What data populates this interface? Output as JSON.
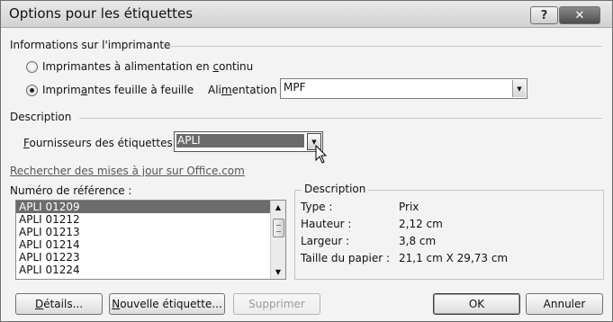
{
  "window": {
    "title": "Options pour les étiquettes",
    "help_label": "?",
    "close_label": "✕"
  },
  "printer_info": {
    "group_label": "Informations sur l'imprimante",
    "continuous_radio": {
      "pre": "Imprimantes à alimentation en ",
      "u": "c",
      "post": "ontinu",
      "checked": false
    },
    "sheet_radio": {
      "pre": "Imprim",
      "u": "a",
      "post": "ntes feuille à feuille",
      "checked": true
    },
    "feed": {
      "pre": "Ali",
      "u": "m",
      "post": "entation :",
      "value": "MPF"
    }
  },
  "description_section": {
    "group_label": "Description",
    "vendor": {
      "u": "F",
      "post": "ournisseurs des étiquettes :",
      "value": "APLI"
    }
  },
  "update_link": "Rechercher des mises à jour sur Office.com",
  "product_list": {
    "label": "Numéro de référence :",
    "items": [
      "APLI 01209",
      "APLI 01212",
      "APLI 01213",
      "APLI 01214",
      "APLI 01223",
      "APLI 01224"
    ],
    "selected_index": 0
  },
  "details": {
    "group_label": "Description",
    "rows": [
      {
        "key": "Type :",
        "value": "Prix"
      },
      {
        "key": "Hauteur :",
        "value": "2,12 cm"
      },
      {
        "key": "Largeur :",
        "value": "3,8 cm"
      },
      {
        "key": "Taille du papier :",
        "value": "21,1 cm X 29,73 cm"
      }
    ]
  },
  "buttons": {
    "details": {
      "u": "D",
      "post": "étails..."
    },
    "new_label": {
      "u": "N",
      "post": "ouvelle étiquette..."
    },
    "delete": "Supprimer",
    "ok": "OK",
    "cancel": "Annuler"
  }
}
